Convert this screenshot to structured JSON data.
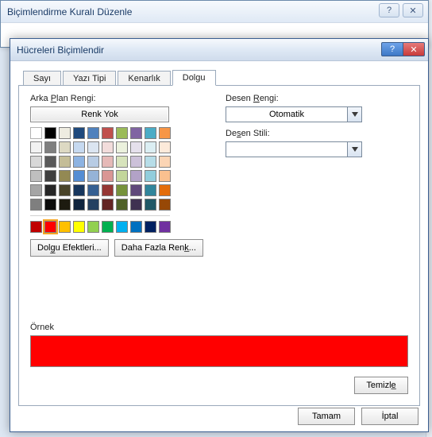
{
  "parentDialog": {
    "title": "Biçimlendirme Kuralı Düzenle",
    "help": "?",
    "close": "✕"
  },
  "dialog": {
    "title": "Hücreleri Biçimlendir",
    "help": "?",
    "close": "✕"
  },
  "tabs": {
    "sayi": "Sayı",
    "yazitipi": "Yazı Tipi",
    "kenarlik": "Kenarlık",
    "dolgu": "Dolgu"
  },
  "fill": {
    "bgColorLabelPrefix": "Arka ",
    "bgColorLabelU": "P",
    "bgColorLabelSuffix": "lan Rengi:",
    "noColor": "Renk Yok",
    "effects": "Dolg̲u Efektleri...",
    "moreColors": "Daha Fazla Renk̲...",
    "patternColorLabelPrefix": "Desen ",
    "patternColorLabelU": "R",
    "patternColorLabelSuffix": "engi:",
    "auto": "Otomatik",
    "patternStyleLabelPrefix": "De",
    "patternStyleLabelU": "s",
    "patternStyleLabelSuffix": "en Stili:",
    "sample": "Örnek",
    "clear": "Temizle̲"
  },
  "footer": {
    "ok": "Tamam",
    "cancel": "İptal"
  },
  "palette_main": [
    [
      "#ffffff",
      "#000000",
      "#eeece1",
      "#1f497d",
      "#4f81bd",
      "#c0504d",
      "#9bbb59",
      "#8064a2",
      "#4bacc6",
      "#f79646"
    ],
    [
      "#f2f2f2",
      "#7f7f7f",
      "#ddd9c3",
      "#c6d9f0",
      "#dbe5f1",
      "#f2dcdb",
      "#ebf1dd",
      "#e5e0ec",
      "#dbeef3",
      "#fdeada"
    ],
    [
      "#d8d8d8",
      "#595959",
      "#c4bd97",
      "#8db3e2",
      "#b8cce4",
      "#e5b9b7",
      "#d7e3bc",
      "#ccc1d9",
      "#b7dde8",
      "#fbd5b5"
    ],
    [
      "#bfbfbf",
      "#3f3f3f",
      "#938953",
      "#548dd4",
      "#95b3d7",
      "#d99694",
      "#c3d69b",
      "#b2a2c7",
      "#92cddc",
      "#fac08f"
    ],
    [
      "#a5a5a5",
      "#262626",
      "#494429",
      "#17365d",
      "#366092",
      "#953734",
      "#76923c",
      "#5f497a",
      "#31859b",
      "#e36c09"
    ],
    [
      "#7f7f7f",
      "#0c0c0c",
      "#1d1b10",
      "#0f243e",
      "#244061",
      "#632423",
      "#4f6128",
      "#3f3151",
      "#205867",
      "#974806"
    ]
  ],
  "palette_std": [
    "#c00000",
    "#ff0000",
    "#ffc000",
    "#ffff00",
    "#92d050",
    "#00b050",
    "#00b0f0",
    "#0070c0",
    "#002060",
    "#7030a0"
  ],
  "selected_std_index": 1,
  "sample_color": "#ff0000"
}
